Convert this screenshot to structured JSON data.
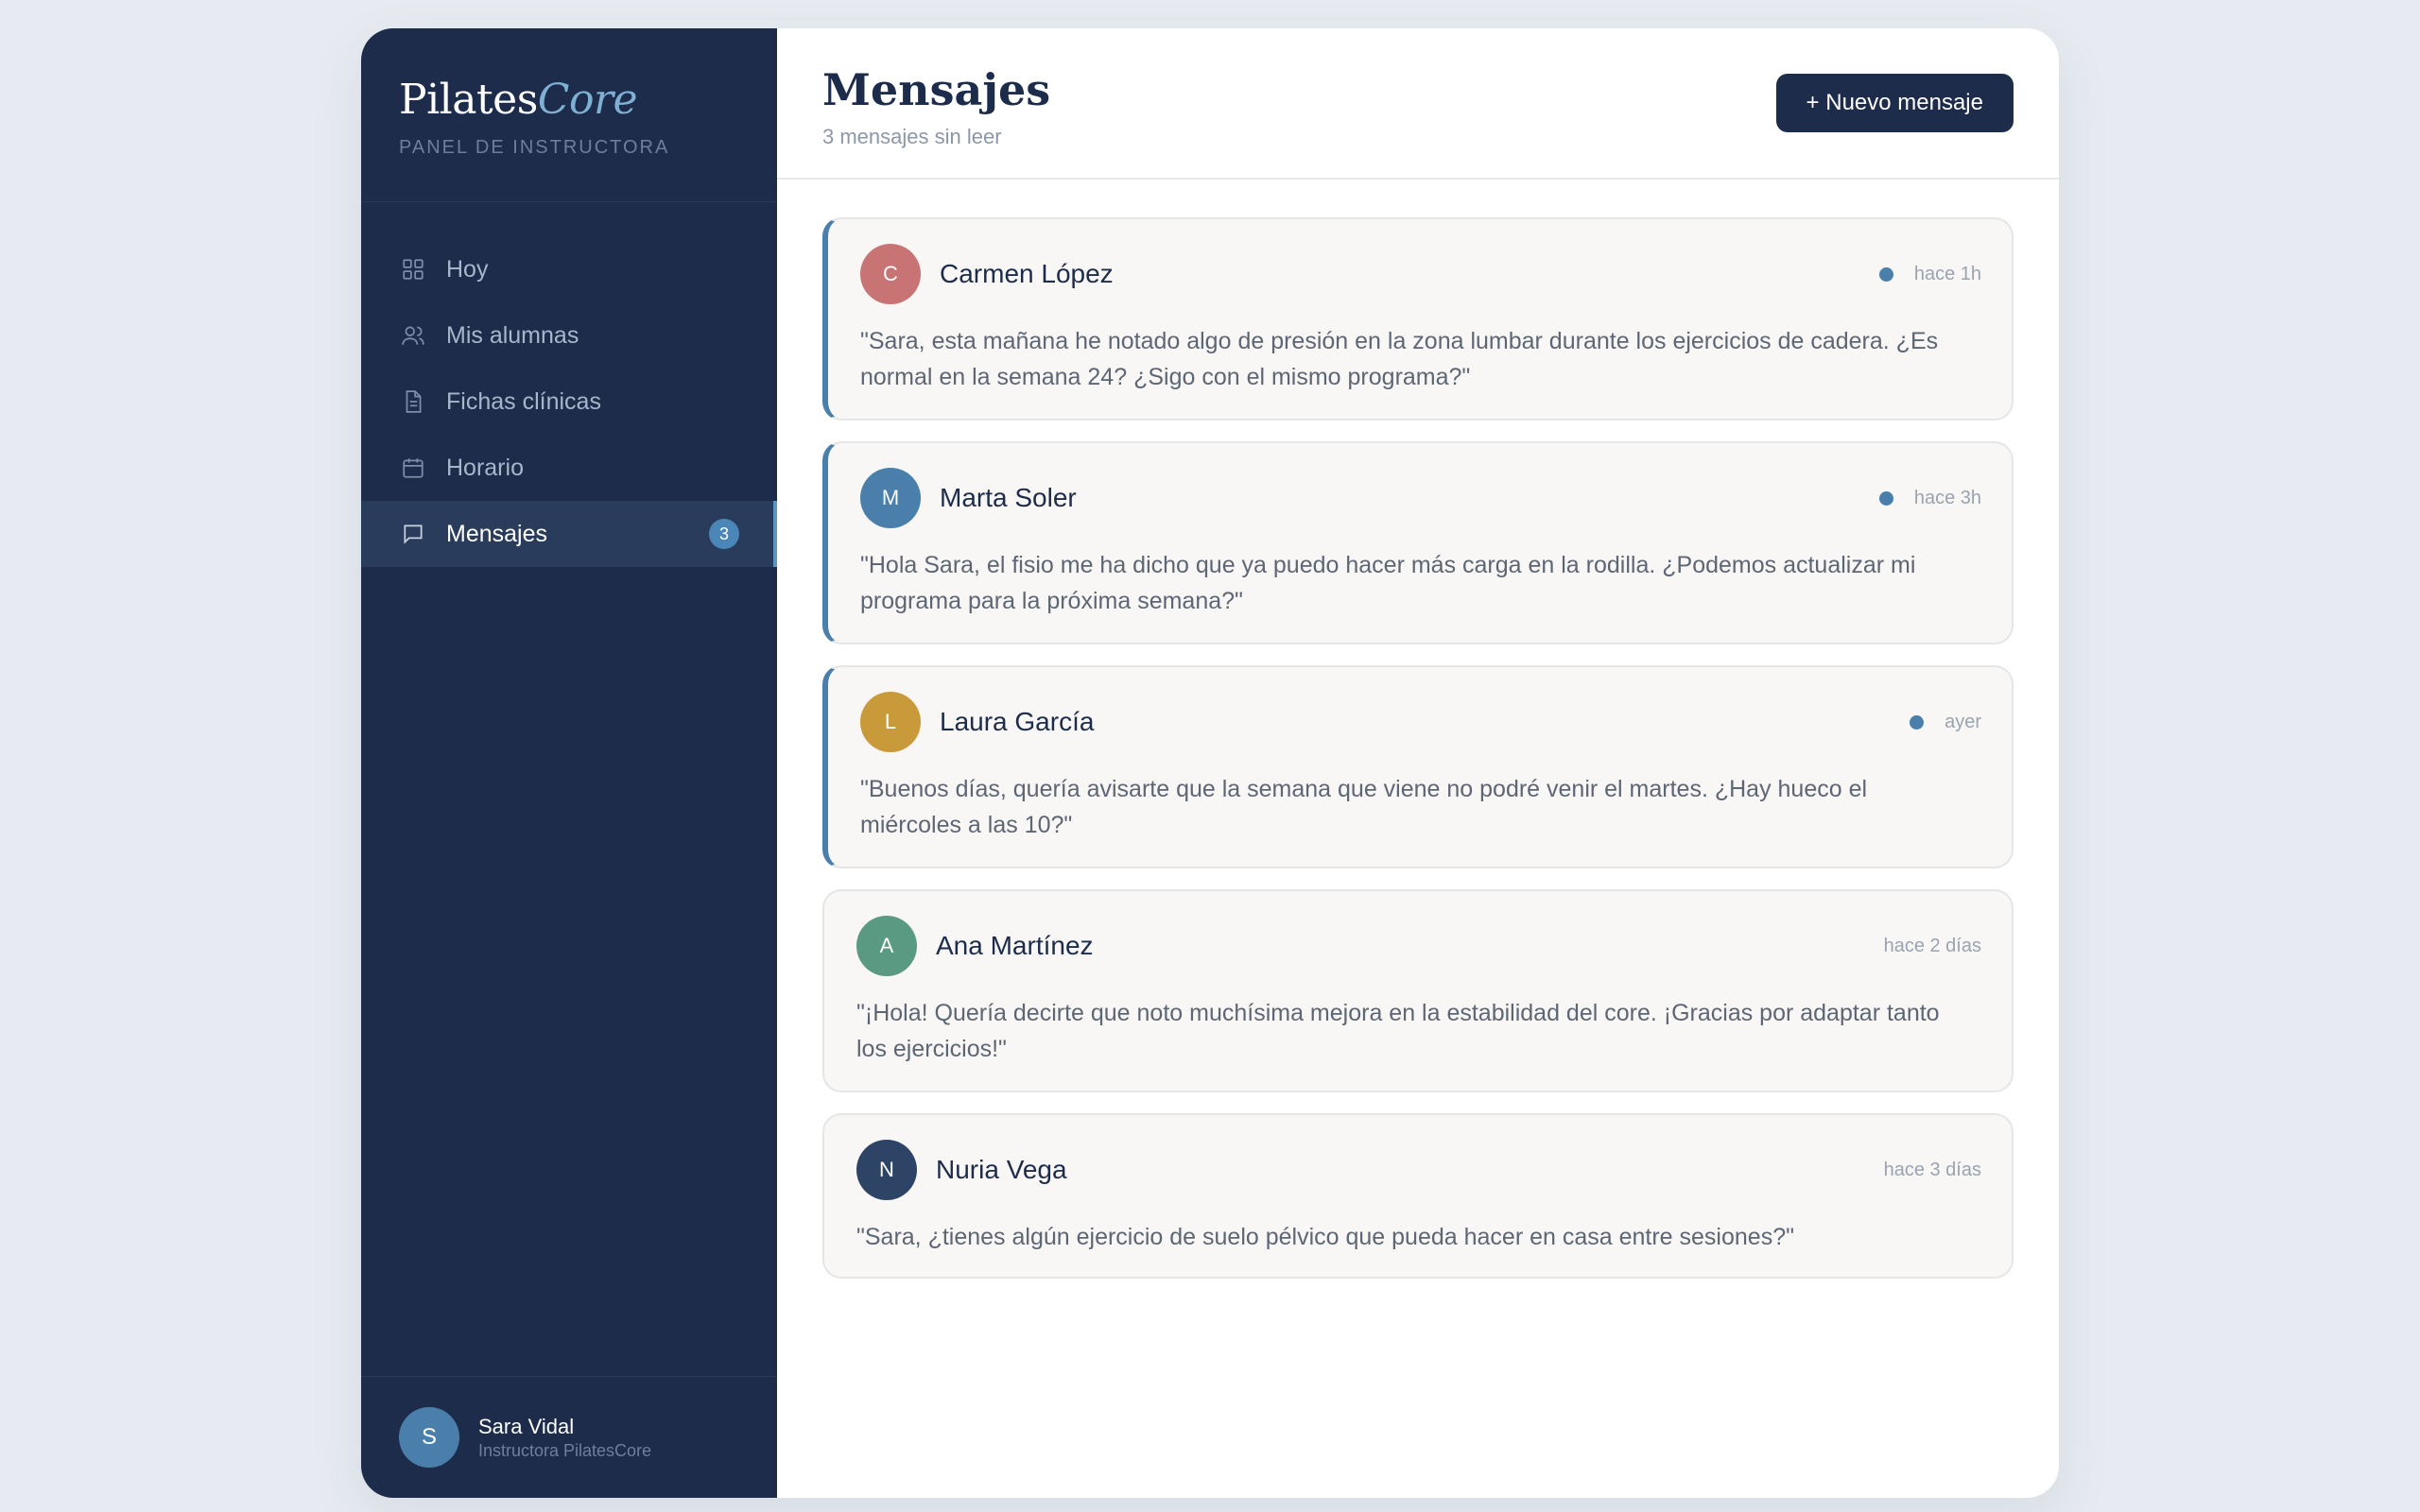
{
  "brand": {
    "name_main": "Pilates",
    "name_accent": "Core",
    "subtitle": "PANEL DE INSTRUCTORA"
  },
  "nav": {
    "items": [
      {
        "label": "Hoy",
        "icon": "grid-icon"
      },
      {
        "label": "Mis alumnas",
        "icon": "users-icon"
      },
      {
        "label": "Fichas clínicas",
        "icon": "document-icon"
      },
      {
        "label": "Horario",
        "icon": "calendar-icon"
      },
      {
        "label": "Mensajes",
        "icon": "chat-icon",
        "badge": "3",
        "active": true
      }
    ]
  },
  "user": {
    "initial": "S",
    "name": "Sara Vidal",
    "role": "Instructora PilatesCore"
  },
  "header": {
    "title": "Mensajes",
    "subtitle": "3 mensajes sin leer",
    "new_button": "+ Nuevo mensaje"
  },
  "messages": [
    {
      "initial": "C",
      "name": "Carmen López",
      "time": "hace 1h",
      "unread": true,
      "color": "#c97474",
      "text": "\"Sara, esta mañana he notado algo de presión en la zona lumbar durante los ejercicios de cadera. ¿Es normal en la semana 24? ¿Sigo con el mismo programa?\""
    },
    {
      "initial": "M",
      "name": "Marta Soler",
      "time": "hace 3h",
      "unread": true,
      "color": "#4a7fab",
      "text": "\"Hola Sara, el fisio me ha dicho que ya puedo hacer más carga en la rodilla. ¿Podemos actualizar mi programa para la próxima semana?\""
    },
    {
      "initial": "L",
      "name": "Laura García",
      "time": "ayer",
      "unread": true,
      "color": "#c99a3a",
      "text": "\"Buenos días, quería avisarte que la semana que viene no podré venir el martes. ¿Hay hueco el miércoles a las 10?\""
    },
    {
      "initial": "A",
      "name": "Ana Martínez",
      "time": "hace 2 días",
      "unread": false,
      "color": "#5a9a82",
      "text": "\"¡Hola! Quería decirte que noto muchísima mejora en la estabilidad del core. ¡Gracias por adaptar tanto los ejercicios!\""
    },
    {
      "initial": "N",
      "name": "Nuria Vega",
      "time": "hace 3 días",
      "unread": false,
      "color": "#2e4466",
      "text": "\"Sara, ¿tienes algún ejercicio de suelo pélvico que pueda hacer en casa entre sesiones?\""
    }
  ]
}
